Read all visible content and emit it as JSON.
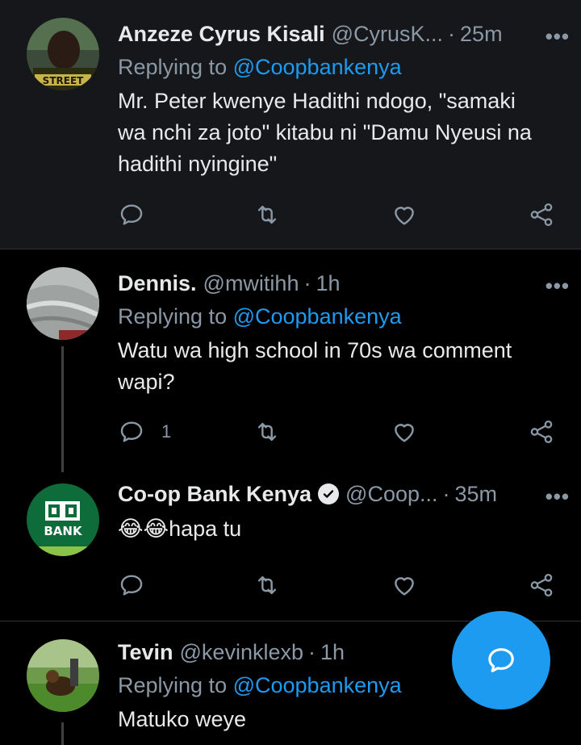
{
  "tweets": [
    {
      "name": "Anzeze Cyrus Kisali",
      "handle": "@CyrusK...",
      "time": "25m",
      "replying_prefix": "Replying to ",
      "replying_to": "@Coopbankenya",
      "text_lines": [
        "Mr. Peter kwenye Hadithi ndogo, \"samaki",
        "wa nchi za joto\" kitabu ni \"Damu Nyeusi na",
        "hadithi nyingine\""
      ],
      "avatar_text": "STREET"
    },
    {
      "name": "Dennis.",
      "handle": "@mwitihh",
      "time": "1h",
      "replying_prefix": "Replying to ",
      "replying_to": "@Coopbankenya",
      "text_lines": [
        "Watu wa high school in 70s wa comment",
        "wapi?"
      ],
      "reply_count": "1"
    },
    {
      "name": "Co-op Bank Kenya",
      "handle": "@Coop...",
      "time": "35m",
      "text": "😂😂hapa tu",
      "avatar_text": "BANK"
    },
    {
      "name": "Tevin",
      "handle": "@kevinklexb",
      "time": "1h",
      "replying_prefix": "Replying to ",
      "replying_to": "@Coopbankenya",
      "text_lines": [
        "Matuko weye"
      ]
    }
  ],
  "separator": "·",
  "more_label": "•••",
  "colors": {
    "background": "#000000",
    "accent": "#1d9bf0",
    "muted": "#8b98a5",
    "highlight_bg": "#15171a"
  },
  "icons": [
    "reply-icon",
    "retweet-icon",
    "like-icon",
    "share-icon",
    "more-icon",
    "verified-icon",
    "compose-reply-icon"
  ]
}
